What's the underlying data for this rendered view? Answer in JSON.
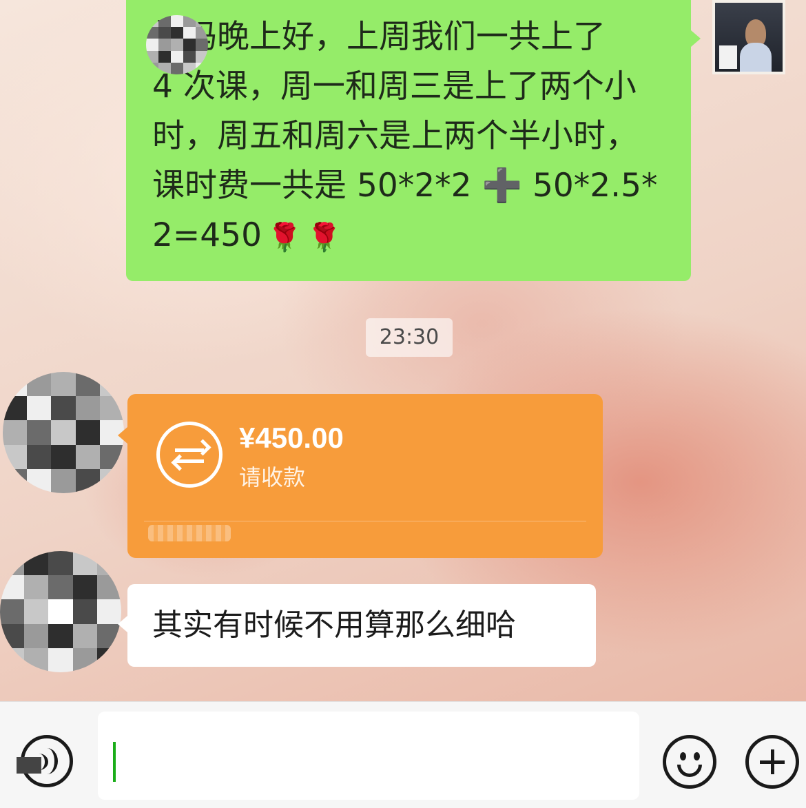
{
  "messages": {
    "payment_request": {
      "lines": [
        "妈妈晚上好，上周我们一共上了",
        "4 次课，周一和周三是上了两个小",
        "时，周五和周六是上两个半小时，",
        "课时费一共是 50*2*2 ➕ 50*2.5*",
        "2=450"
      ],
      "emoji_1": "🌹",
      "emoji_2": "🌹"
    },
    "timestamp": "23:30",
    "transfer": {
      "amount": "¥450.00",
      "status": "请收款"
    },
    "reply": "其实有时候不用算那么细哈"
  },
  "input_bar": {
    "text_value": ""
  },
  "icons": {
    "voice": "voice-icon",
    "emoji": "emoji-face-icon",
    "more": "plus-circle-icon",
    "transfer": "transfer-arrows-icon",
    "rose": "rose-emoji"
  },
  "colors": {
    "sent_bubble": "#95ec69",
    "transfer_card": "#f79c3b",
    "received_bubble": "#ffffff",
    "input_bar": "#f6f6f6"
  }
}
